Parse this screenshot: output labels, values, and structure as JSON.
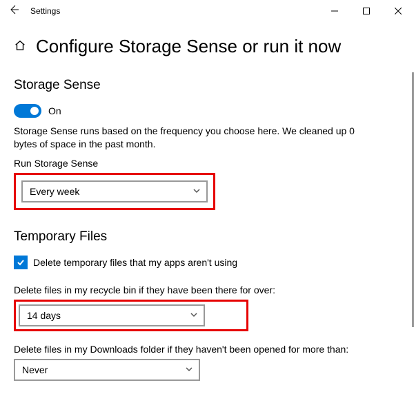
{
  "window": {
    "title": "Settings"
  },
  "page": {
    "heading": "Configure Storage Sense or run it now"
  },
  "storageSense": {
    "heading": "Storage Sense",
    "toggleLabel": "On",
    "description": "Storage Sense runs based on the frequency you choose here. We cleaned up 0 bytes of space in the past month.",
    "runLabel": "Run Storage Sense",
    "runValue": "Every week"
  },
  "temporaryFiles": {
    "heading": "Temporary Files",
    "deleteTempLabel": "Delete temporary files that my apps aren't using",
    "recycleLabel": "Delete files in my recycle bin if they have been there for over:",
    "recycleValue": "14 days",
    "downloadsLabel": "Delete files in my Downloads folder if they haven't been opened for more than:",
    "downloadsValue": "Never"
  }
}
